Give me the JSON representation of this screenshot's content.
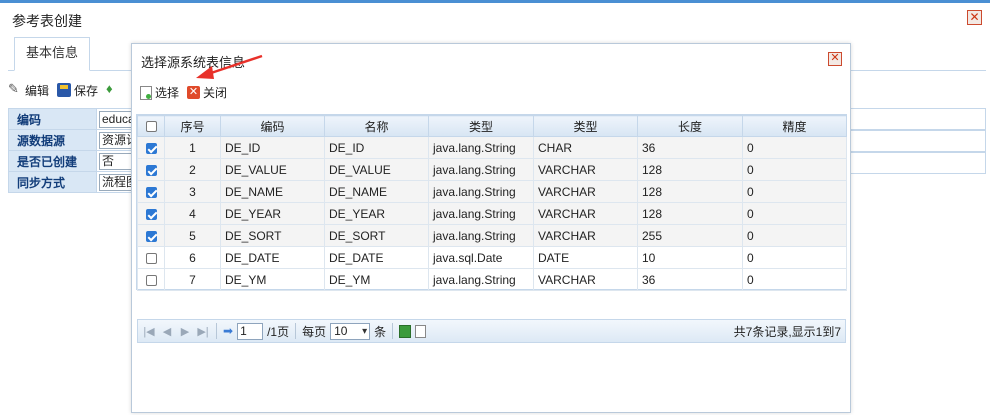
{
  "window": {
    "title": "参考表创建"
  },
  "tabs": [
    {
      "label": "基本信息"
    }
  ],
  "toolbar": {
    "edit_label": "编辑",
    "save_label": "保存"
  },
  "form": {
    "rows": [
      {
        "label": "编码",
        "value": "educa"
      },
      {
        "label": "源数据源",
        "value": "资源计"
      },
      {
        "label": "是否已创建",
        "value": "否"
      },
      {
        "label": "同步方式",
        "value": "流程图"
      }
    ]
  },
  "dialog": {
    "title": "选择源系统表信息",
    "select_label": "选择",
    "close_label": "关闭",
    "columns": [
      "序号",
      "编码",
      "名称",
      "类型",
      "类型",
      "长度",
      "精度"
    ],
    "rows": [
      {
        "checked": true,
        "no": "1",
        "code": "DE_ID",
        "name": "DE_ID",
        "java_type": "java.lang.String",
        "db_type": "CHAR",
        "length": "36",
        "precision": "0"
      },
      {
        "checked": true,
        "no": "2",
        "code": "DE_VALUE",
        "name": "DE_VALUE",
        "java_type": "java.lang.String",
        "db_type": "VARCHAR",
        "length": "128",
        "precision": "0"
      },
      {
        "checked": true,
        "no": "3",
        "code": "DE_NAME",
        "name": "DE_NAME",
        "java_type": "java.lang.String",
        "db_type": "VARCHAR",
        "length": "128",
        "precision": "0"
      },
      {
        "checked": true,
        "no": "4",
        "code": "DE_YEAR",
        "name": "DE_YEAR",
        "java_type": "java.lang.String",
        "db_type": "VARCHAR",
        "length": "128",
        "precision": "0"
      },
      {
        "checked": true,
        "no": "5",
        "code": "DE_SORT",
        "name": "DE_SORT",
        "java_type": "java.lang.String",
        "db_type": "VARCHAR",
        "length": "255",
        "precision": "0"
      },
      {
        "checked": false,
        "no": "6",
        "code": "DE_DATE",
        "name": "DE_DATE",
        "java_type": "java.sql.Date",
        "db_type": "DATE",
        "length": "10",
        "precision": "0"
      },
      {
        "checked": false,
        "no": "7",
        "code": "DE_YM",
        "name": "DE_YM",
        "java_type": "java.lang.String",
        "db_type": "VARCHAR",
        "length": "36",
        "precision": "0"
      }
    ],
    "pager": {
      "page_value": "1",
      "page_total": "/1页",
      "per_page_label": "每页",
      "per_page_value": "10",
      "per_page_unit": "条",
      "info": "共7条记录,显示1到7"
    }
  },
  "colors": {
    "accent": "#4a8fd3",
    "header_bg": "#d9e7f5",
    "check": "#2c78d4",
    "arrow": "#e8312a"
  }
}
